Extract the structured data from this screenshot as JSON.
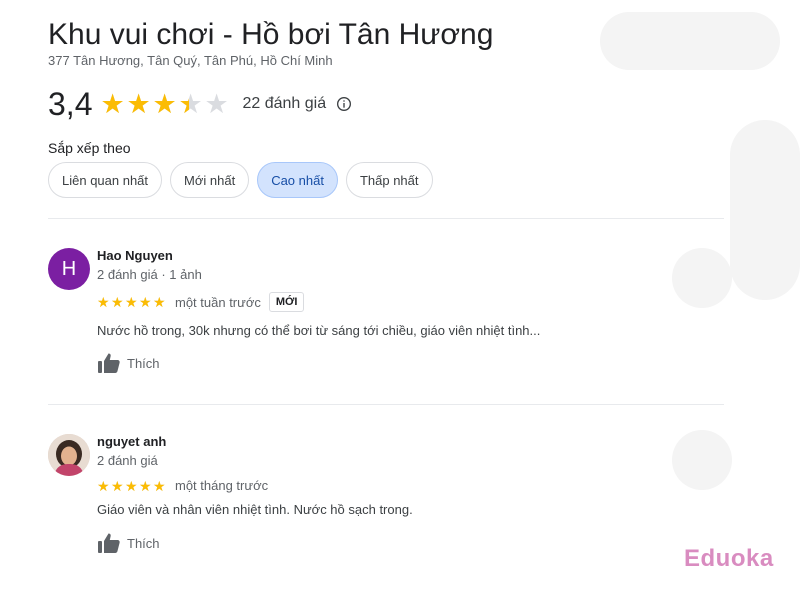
{
  "place": {
    "title": "Khu vui chơi - Hồ bơi Tân Hương",
    "address": "377 Tân Hương, Tân Quý, Tân Phú, Hồ Chí Minh",
    "rating_value": "3,4",
    "rating": 3.4,
    "review_count": "22 đánh giá"
  },
  "sort": {
    "label": "Sắp xếp theo",
    "options": [
      "Liên quan nhất",
      "Mới nhất",
      "Cao nhất",
      "Thấp nhất"
    ],
    "selected": "Cao nhất"
  },
  "reviews": [
    {
      "avatar_letter": "H",
      "author": "Hao Nguyen",
      "meta": "2 đánh giá · 1 ảnh",
      "rating": 5,
      "date": "một tuần trước",
      "badge": "MỚI",
      "text": "Nước hồ trong, 30k nhưng có thể bơi từ sáng tới chiều, giáo viên nhiệt tình...",
      "like_label": "Thích"
    },
    {
      "author": "nguyet anh",
      "meta": "2 đánh giá",
      "rating": 5,
      "date": "một tháng trước",
      "text": "Giáo viên và nhân viên nhiệt tình. Nước hồ sạch trong.",
      "like_label": "Thích"
    }
  ],
  "watermark": "Eduoka",
  "colors": {
    "star": "#fbbc04",
    "star_empty": "#dadce0",
    "chip_active_bg": "#d3e3fd",
    "avatar_letter_bg": "#7b1fa2",
    "watermark": "#d98cc0"
  },
  "icons": {
    "info": "info-icon",
    "like": "thumbs-up-icon",
    "star": "star-icon"
  }
}
